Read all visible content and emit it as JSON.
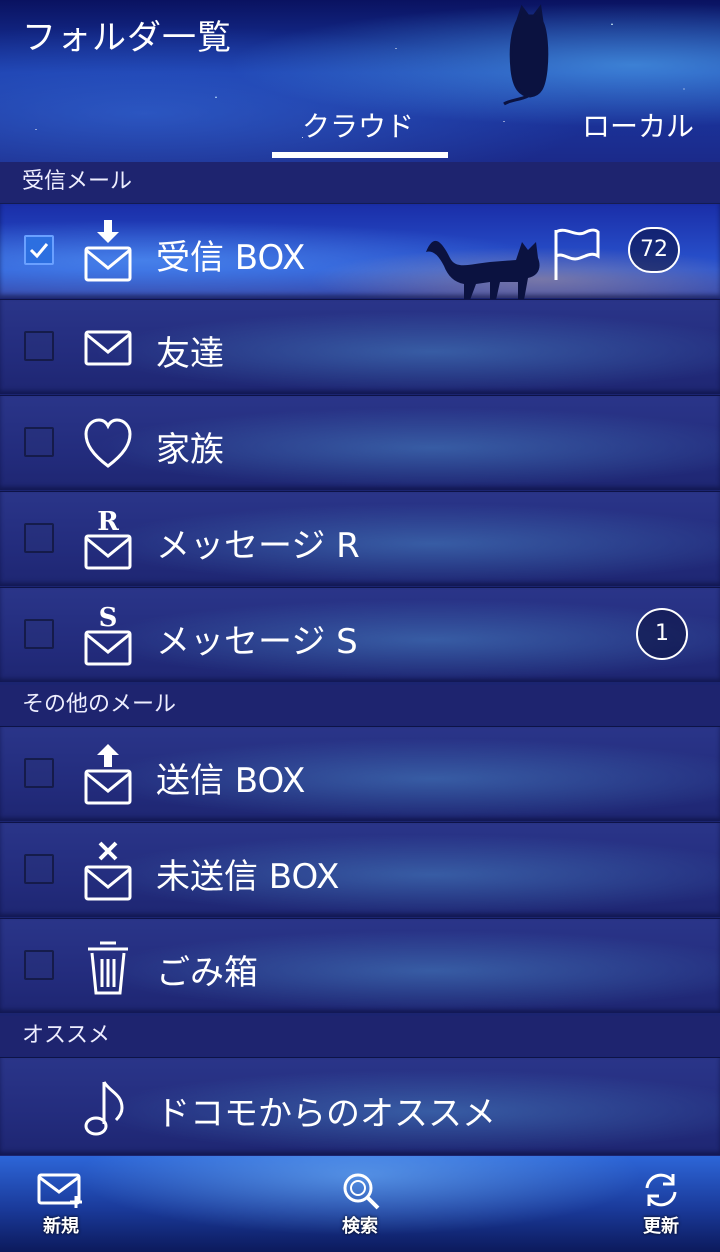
{
  "header": {
    "title": "フォルダ一覧",
    "tabs": [
      {
        "label": "クラウド",
        "active": true
      },
      {
        "label": "ローカル",
        "active": false
      }
    ]
  },
  "sections": [
    {
      "title": "受信メール",
      "folders": [
        {
          "label": "受信 BOX",
          "icon": "inbox-icon",
          "checked": true,
          "flag": true,
          "badge": "72"
        },
        {
          "label": "友達",
          "icon": "mail-icon",
          "checked": false
        },
        {
          "label": "家族",
          "icon": "heart-icon",
          "checked": false
        },
        {
          "label": "メッセージ R",
          "icon": "message-r-icon",
          "icon_letter": "R",
          "checked": false
        },
        {
          "label": "メッセージ S",
          "icon": "message-s-icon",
          "icon_letter": "S",
          "checked": false,
          "badge": "1"
        }
      ]
    },
    {
      "title": "その他のメール",
      "folders": [
        {
          "label": "送信 BOX",
          "icon": "outbox-icon",
          "checked": false
        },
        {
          "label": "未送信 BOX",
          "icon": "unsent-icon",
          "checked": false
        },
        {
          "label": "ごみ箱",
          "icon": "trash-icon",
          "checked": false
        }
      ]
    },
    {
      "title": "オススメ",
      "folders": [
        {
          "label": "ドコモからのオススメ",
          "icon": "music-note-icon"
        }
      ]
    }
  ],
  "footer": {
    "new_label": "新規",
    "search_label": "検索",
    "refresh_label": "更新"
  },
  "colors": {
    "accent": "#2c6fe0",
    "background": "#1b2470",
    "text": "#ffffff"
  }
}
